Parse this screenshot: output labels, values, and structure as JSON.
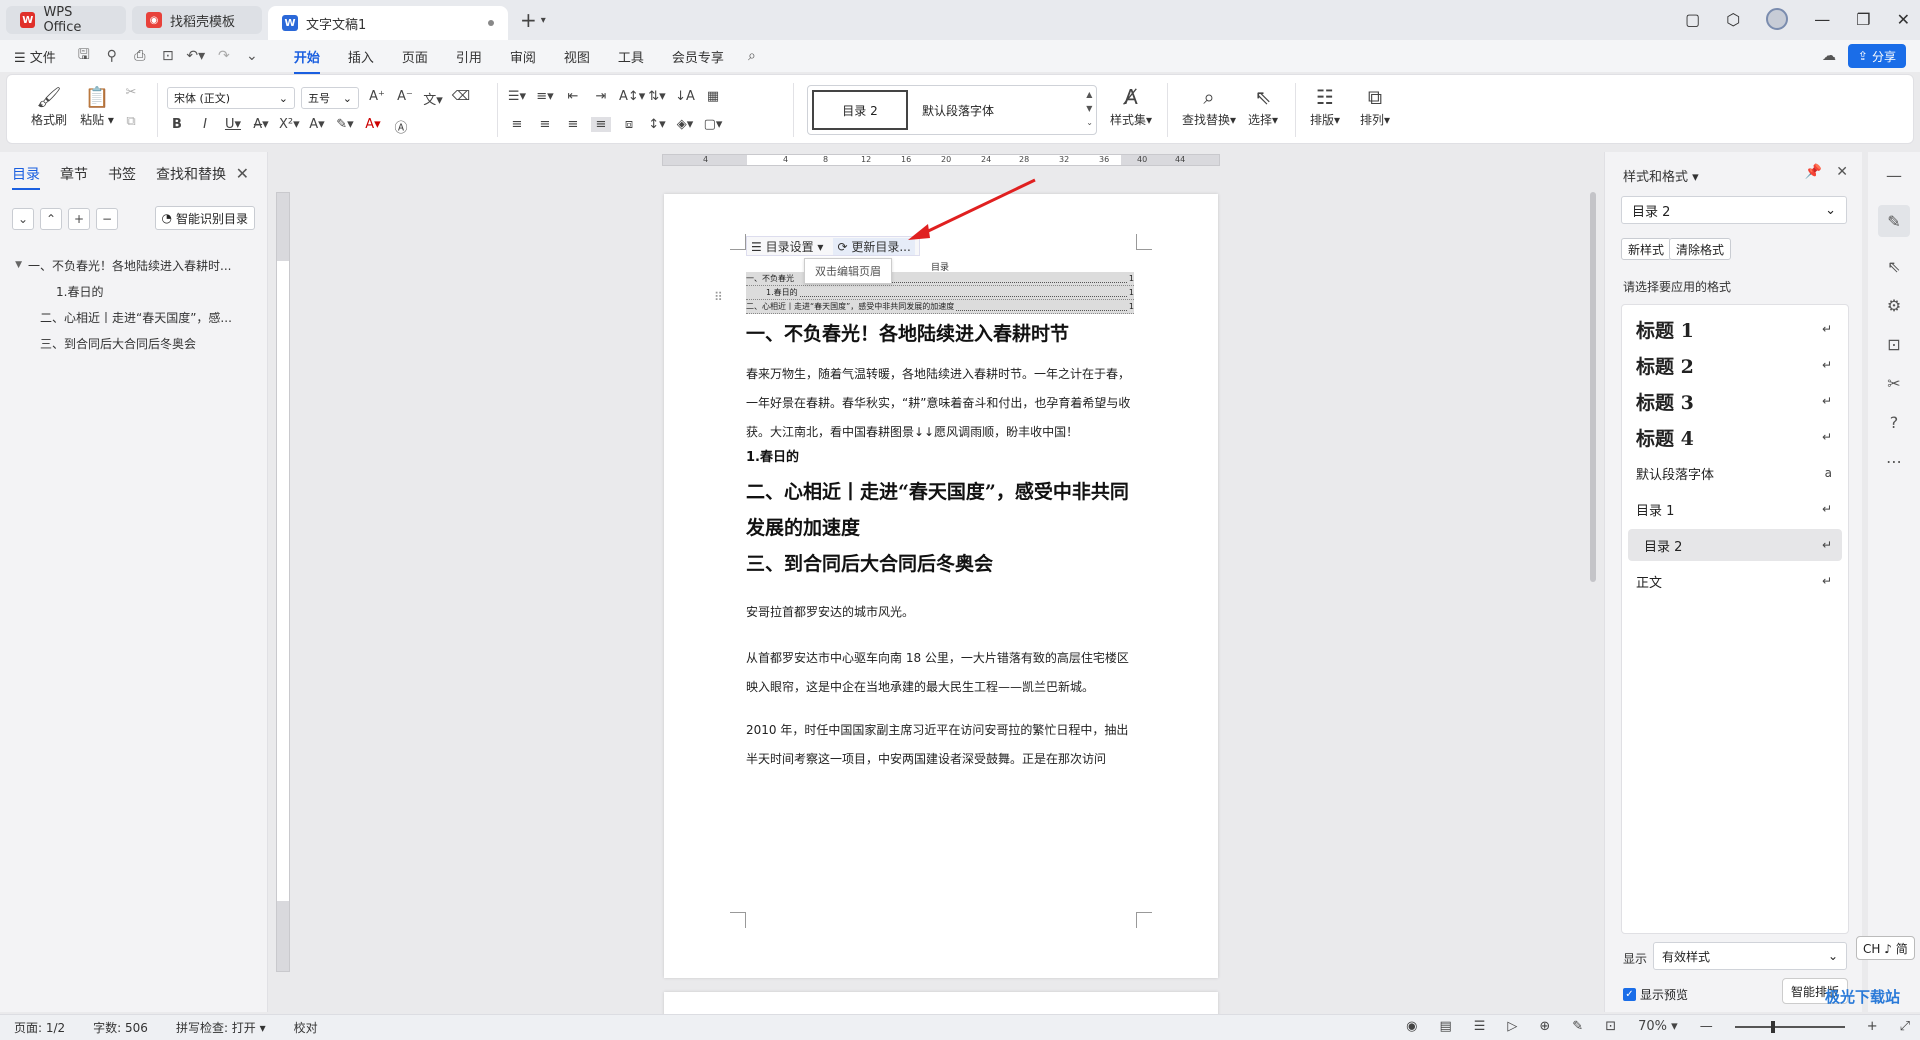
{
  "tabs": {
    "app": "WPS Office",
    "template": "找稻壳模板",
    "doc": "文字文稿1"
  },
  "menu": {
    "file": "文件",
    "items": [
      "开始",
      "插入",
      "页面",
      "引用",
      "审阅",
      "视图",
      "工具",
      "会员专享"
    ],
    "active": "开始",
    "share": "分享"
  },
  "ribbon": {
    "format_painter": "格式刷",
    "paste": "粘贴",
    "font_name": "宋体 (正文)",
    "font_size": "五号",
    "style_selected": "目录 2",
    "style_other": "默认段落字体",
    "style_set": "样式集",
    "find_replace": "查找替换",
    "select": "选择",
    "layout": "排版",
    "arrange": "排列"
  },
  "left_panel": {
    "tabs": [
      "目录",
      "章节",
      "书签",
      "查找和替换"
    ],
    "active_tab": "目录",
    "smart_toc": "智能识别目录",
    "toc_items": [
      {
        "label": "一、不负春光！各地陆续进入春耕时...",
        "level": 1,
        "expanded": true
      },
      {
        "label": "1.春日的",
        "level": 2
      },
      {
        "label": "二、心相近丨走进“春天国度”，感...",
        "level": 1
      },
      {
        "label": "三、到合同后大合同后冬奥会",
        "level": 1
      }
    ]
  },
  "document": {
    "toc_settings": "目录设置",
    "toc_update": "更新目录...",
    "tooltip": "双击编辑页眉",
    "toc_title": "目录",
    "toc_rows": [
      {
        "text": "一、不负春光",
        "tail": "节",
        "page": "1"
      },
      {
        "text": "1.春日的",
        "page": "1"
      },
      {
        "text": "二、心相近丨走进“春天国度”，感受中非共同发展的加速度",
        "page": "1"
      }
    ],
    "h1_a": "一、不负春光！各地陆续进入春耕时节",
    "p1": "春来万物生，随着气温转暖，各地陆续进入春耕时节。一年之计在于春，一年好景在春耕。春华秋实，“耕”意味着奋斗和付出，也孕育着希望与收获。大江南北，看中国春耕图景↓↓愿风调雨顺，盼丰收中国！",
    "h2": "1.春日的",
    "h1_b": "二、心相近丨走进“春天国度”，感受中非共同发展的加速度",
    "h1_c": "三、到合同后大合同后冬奥会",
    "p2": "安哥拉首都罗安达的城市风光。",
    "p3": "从首都罗安达市中心驱车向南 18 公里，一大片错落有致的高层住宅楼区映入眼帘，这是中企在当地承建的最大民生工程——凯兰巴新城。",
    "p4": "2010 年，时任中国国家副主席习近平在访问安哥拉的繁忙日程中，抽出半天时间考察这一项目，中安两国建设者深受鼓舞。正是在那次访问"
  },
  "right_panel": {
    "title": "样式和格式",
    "current_style": "目录 2",
    "new_style": "新样式",
    "clear_format": "清除格式",
    "hint": "请选择要应用的格式",
    "styles": [
      {
        "label": "标题  1",
        "kind": "heading",
        "mark": "↵"
      },
      {
        "label": "标题  2",
        "kind": "heading",
        "mark": "↵"
      },
      {
        "label": "标题  3",
        "kind": "heading",
        "mark": "↵"
      },
      {
        "label": "标题  4",
        "kind": "heading",
        "mark": "↵"
      },
      {
        "label": "默认段落字体",
        "kind": "plain",
        "mark": "a"
      },
      {
        "label": "目录  1",
        "kind": "plain",
        "mark": "↵"
      },
      {
        "label": "目录  2",
        "kind": "plain",
        "mark": "↵",
        "selected": true
      },
      {
        "label": "正文",
        "kind": "plain",
        "mark": "↵"
      }
    ],
    "show_label": "显示",
    "show_value": "有效样式",
    "show_preview": "显示预览",
    "smart_layout": "智能排版"
  },
  "ime": "CH ♪ 简",
  "status": {
    "page": "页面: 1/2",
    "words": "字数: 506",
    "spell": "拼写检查: 打开",
    "proof": "校对",
    "zoom": "70%"
  },
  "watermark": "极光下载站",
  "colors": {
    "accent": "#1a5fe0",
    "share_bg": "#1a6de8",
    "annotation_arrow": "#e02020"
  }
}
